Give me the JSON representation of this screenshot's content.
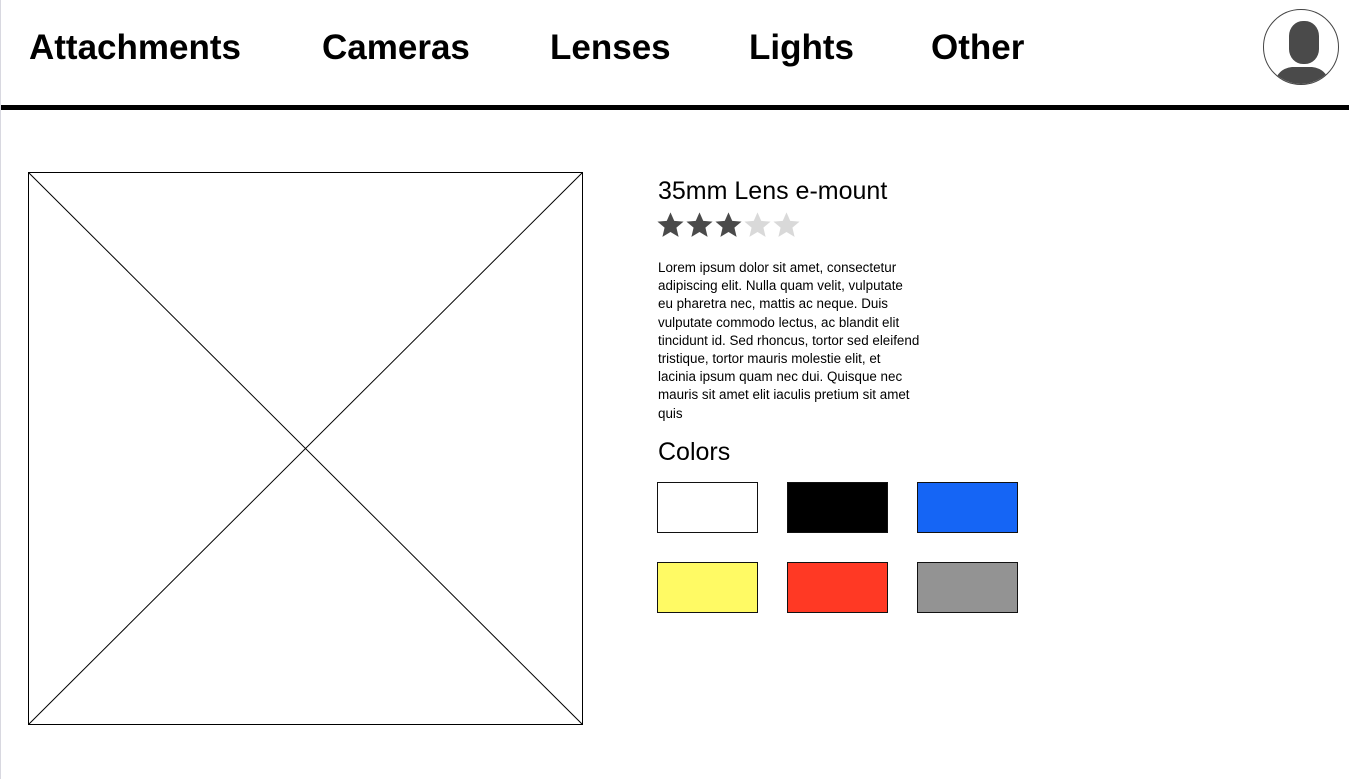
{
  "nav": {
    "items": [
      {
        "label": "Attachments"
      },
      {
        "label": "Cameras"
      },
      {
        "label": "Lenses"
      },
      {
        "label": "Lights"
      },
      {
        "label": "Other"
      }
    ],
    "avatar_icon": "user-avatar-icon"
  },
  "product": {
    "image_icon": "image-placeholder-icon",
    "title": "35mm Lens e-mount",
    "rating": {
      "value": 3,
      "max": 5,
      "filled_color": "#4a4a4a",
      "empty_color": "#d9d9d9"
    },
    "description": "Lorem ipsum dolor sit amet, consectetur adipiscing elit. Nulla quam velit, vulputate eu pharetra nec, mattis ac neque. Duis vulputate commodo lectus, ac blandit elit tincidunt id. Sed rhoncus, tortor sed eleifend tristique, tortor mauris molestie elit, et lacinia ipsum quam nec dui. Quisque nec mauris sit amet elit iaculis pretium sit amet quis",
    "colors_title": "Colors",
    "colors": [
      {
        "name": "white",
        "hex": "#ffffff"
      },
      {
        "name": "black",
        "hex": "#000000"
      },
      {
        "name": "blue",
        "hex": "#1565f5"
      },
      {
        "name": "yellow",
        "hex": "#fffa64"
      },
      {
        "name": "red",
        "hex": "#ff3924"
      },
      {
        "name": "gray",
        "hex": "#939393"
      }
    ]
  }
}
